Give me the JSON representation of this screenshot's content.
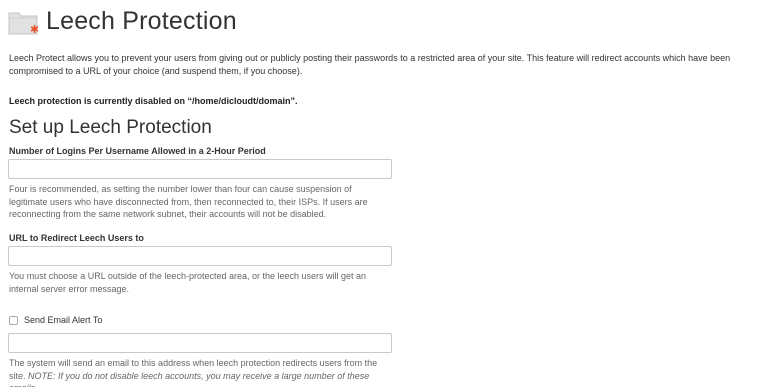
{
  "header": {
    "title": "Leech Protection",
    "icon": "folder-star-icon"
  },
  "intro": "Leech Protect allows you to prevent your users from giving out or publicly posting their passwords to a restricted area of your site. This feature will redirect accounts which have been compromised to a URL of your choice (and suspend them, if you choose).",
  "status": "Leech protection is currently disabled on “/home/dicloudt/domain”.",
  "setup": {
    "title": "Set up Leech Protection",
    "logins": {
      "label": "Number of Logins Per Username Allowed in a 2-Hour Period",
      "value": "",
      "help": "Four is recommended, as setting the number lower than four can cause suspension of legitimate users who have disconnected from, then reconnected to, their ISPs. If users are reconnecting from the same network subnet, their accounts will not be disabled."
    },
    "redirect": {
      "label": "URL to Redirect Leech Users to",
      "value": "",
      "help": "You must choose a URL outside of the leech-protected area, or the leech users will get an internal server error message."
    },
    "email": {
      "checkbox_label": "Send Email Alert To",
      "checked": false,
      "value": "",
      "help": "The system will send an email to this address when leech protection redirects users from the site.",
      "note": "NOTE: If you do not disable leech accounts, you may receive a large number of these emails."
    }
  },
  "colors": {
    "folder": "#d6d6d6",
    "star": "#e8502a"
  }
}
